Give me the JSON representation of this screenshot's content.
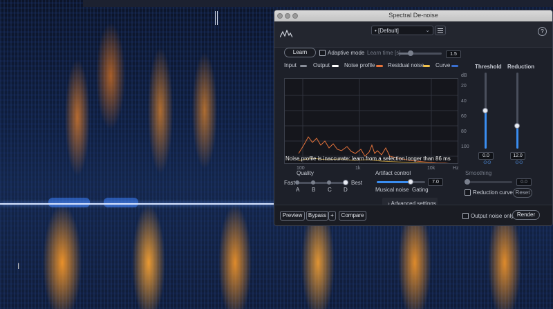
{
  "window": {
    "title": "Spectral De-noise"
  },
  "header": {
    "preset_label": "[Default]",
    "preset_marker": "•",
    "help_label": "?"
  },
  "controls": {
    "learn_label": "Learn",
    "adaptive_label": "Adaptive mode",
    "adaptive_checked": false,
    "learn_time_label": "Learn time [s]",
    "learn_time_value": "1.5"
  },
  "legend": [
    {
      "label": "Input",
      "color": "#8a8f9a"
    },
    {
      "label": "Output",
      "color": "#ffffff"
    },
    {
      "label": "Noise profile",
      "color": "#e8743b"
    },
    {
      "label": "Residual noise",
      "color": "#f3c24a"
    },
    {
      "label": "Curve",
      "color": "#3a6fd0"
    }
  ],
  "graph": {
    "db_label": "dB",
    "db_ticks": [
      "20",
      "40",
      "60",
      "80",
      "100"
    ],
    "freq_ticks": [
      "100",
      "1k",
      "10k",
      "Hz"
    ],
    "warning": "Noise profile is inaccurate: learn from a selection longer than 86 ms"
  },
  "threshold": {
    "label": "Threshold",
    "value": "0.0",
    "level_fraction": 0.5
  },
  "reduction": {
    "label": "Reduction",
    "value": "12.0",
    "level_fraction": 0.3
  },
  "quality": {
    "label": "Quality",
    "fast_label": "Fast",
    "best_label": "Best",
    "options": [
      "A",
      "B",
      "C",
      "D"
    ],
    "selected": "D"
  },
  "artifact": {
    "label": "Artifact control",
    "musical_noise_label": "Musical noise",
    "gating_label": "Gating",
    "value": "7.0",
    "level_fraction": 0.7
  },
  "smoothing": {
    "label": "Smoothing",
    "value": "0.0"
  },
  "reduction_curve": {
    "label": "Reduction curve",
    "checked": false,
    "reset_label": "Reset"
  },
  "advanced": {
    "label": "Advanced settings",
    "chevron": "›"
  },
  "footer": {
    "preview_label": "Preview",
    "bypass_label": "Bypass",
    "plus_label": "+",
    "compare_label": "Compare",
    "output_noise_label": "Output noise only",
    "output_noise_checked": false,
    "render_label": "Render"
  },
  "editor": {
    "cursor_glyph": "I"
  }
}
